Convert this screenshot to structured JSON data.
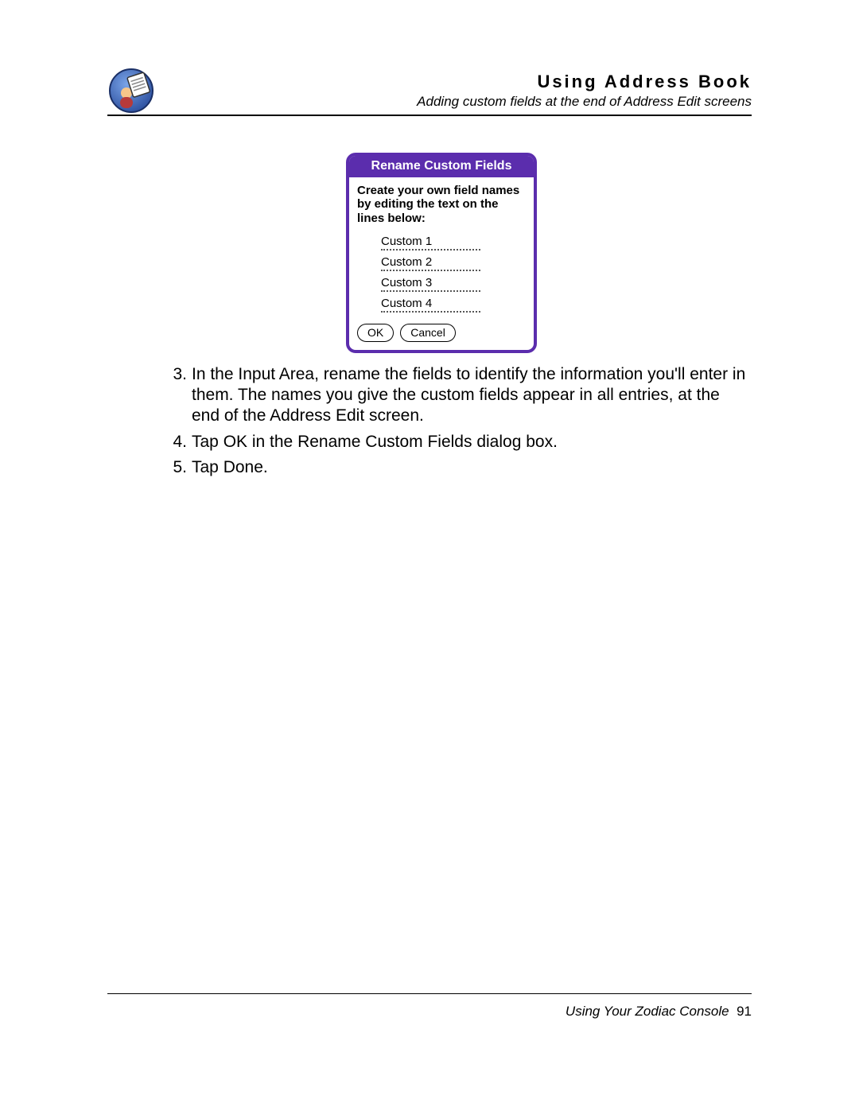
{
  "header": {
    "chapter": "Using Address Book",
    "section": "Adding custom fields at the end of Address Edit screens"
  },
  "dialog": {
    "title": "Rename Custom Fields",
    "instruction": "Create your own field names by editing the text on the lines below:",
    "fields": [
      "Custom 1",
      "Custom 2",
      "Custom 3",
      "Custom 4"
    ],
    "ok": "OK",
    "cancel": "Cancel"
  },
  "steps": [
    {
      "n": "3.",
      "text": "In the Input Area, rename the fields to identify the information you'll enter in them. The names you give the custom fields appear in all entries, at the end of the Address Edit screen."
    },
    {
      "n": "4.",
      "text": "Tap OK in the Rename Custom Fields dialog box."
    },
    {
      "n": "5.",
      "text": "Tap Done."
    }
  ],
  "footer": {
    "book": "Using Your Zodiac Console",
    "page": "91"
  }
}
